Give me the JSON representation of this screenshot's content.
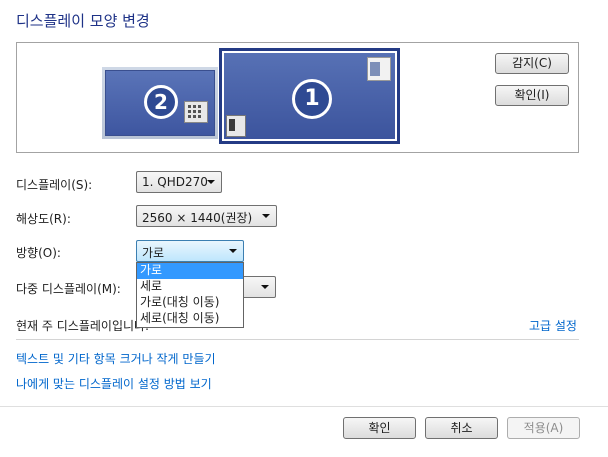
{
  "page_title": "디스플레이 모양 변경",
  "arrangement": {
    "monitor_1_label": "1",
    "monitor_2_label": "2",
    "detect_button": "감지(C)",
    "identify_button": "확인(I)"
  },
  "display": {
    "label": "디스플레이(S):",
    "value": "1. QHD270"
  },
  "resolution": {
    "label": "해상도(R):",
    "value": "2560 × 1440(권장)"
  },
  "orientation": {
    "label": "방향(O):",
    "value": "가로",
    "options": [
      "가로",
      "세로",
      "가로(대칭 이동)",
      "세로(대칭 이동)"
    ],
    "selected_index": 0
  },
  "multiple_displays": {
    "label": "다중 디스플레이(M):"
  },
  "main_display_text": "현재 주 디스플레이입니다.",
  "advanced_settings_link": "고급 설정",
  "links": [
    "텍스트 및 기타 항목 크거나 작게 만들기",
    "나에게 맞는 디스플레이 설정 방법 보기"
  ],
  "footer": {
    "ok": "확인",
    "cancel": "취소",
    "apply": "적용(A)"
  },
  "colors": {
    "title": "#1e3287",
    "link": "#0066cc",
    "highlight": "#3399ff",
    "monitor_bg": "#3c549d"
  }
}
